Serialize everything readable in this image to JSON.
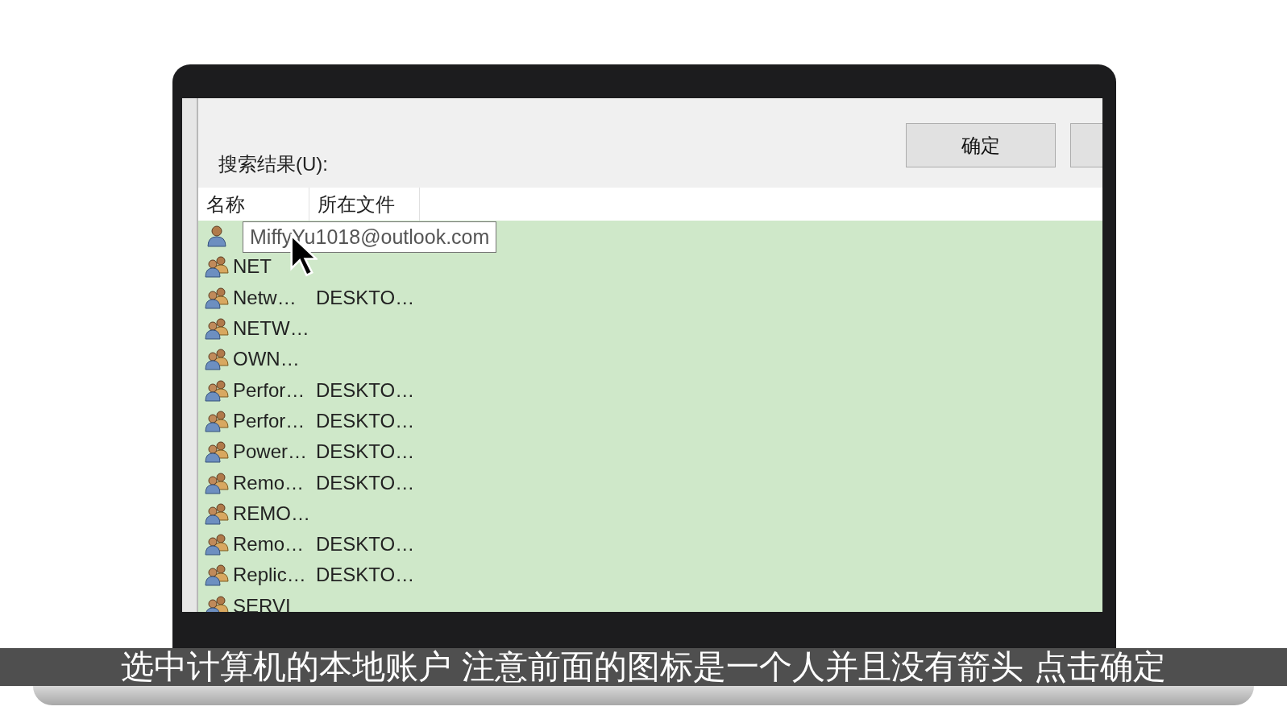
{
  "dialog": {
    "ok_button": "确定",
    "results_label": "搜索结果(U):",
    "columns": [
      "名称",
      "所在文件"
    ],
    "rows": [
      {
        "kind": "user"
      },
      {
        "kind": "group",
        "name": "NET"
      },
      {
        "kind": "group",
        "name": "Netw…",
        "folder": "DESKTO…"
      },
      {
        "kind": "group",
        "name": "NETW…"
      },
      {
        "kind": "group",
        "name": "OWN…"
      },
      {
        "kind": "group",
        "name": "Perfor…",
        "folder": "DESKTO…"
      },
      {
        "kind": "group",
        "name": "Perfor…",
        "folder": "DESKTO…"
      },
      {
        "kind": "group",
        "name": "Power…",
        "folder": "DESKTO…"
      },
      {
        "kind": "group",
        "name": "Remo…",
        "folder": "DESKTO…"
      },
      {
        "kind": "group",
        "name": "REMO…"
      },
      {
        "kind": "group",
        "name": "Remo…",
        "folder": "DESKTO…"
      },
      {
        "kind": "group",
        "name": "Replic…",
        "folder": "DESKTO…"
      },
      {
        "kind": "group",
        "name": "SERVI"
      }
    ],
    "tooltip": "MiffyYu1018@outlook.com"
  },
  "subtitle": "选中计算机的本地账户 注意前面的图标是一个人并且没有箭头 点击确定"
}
